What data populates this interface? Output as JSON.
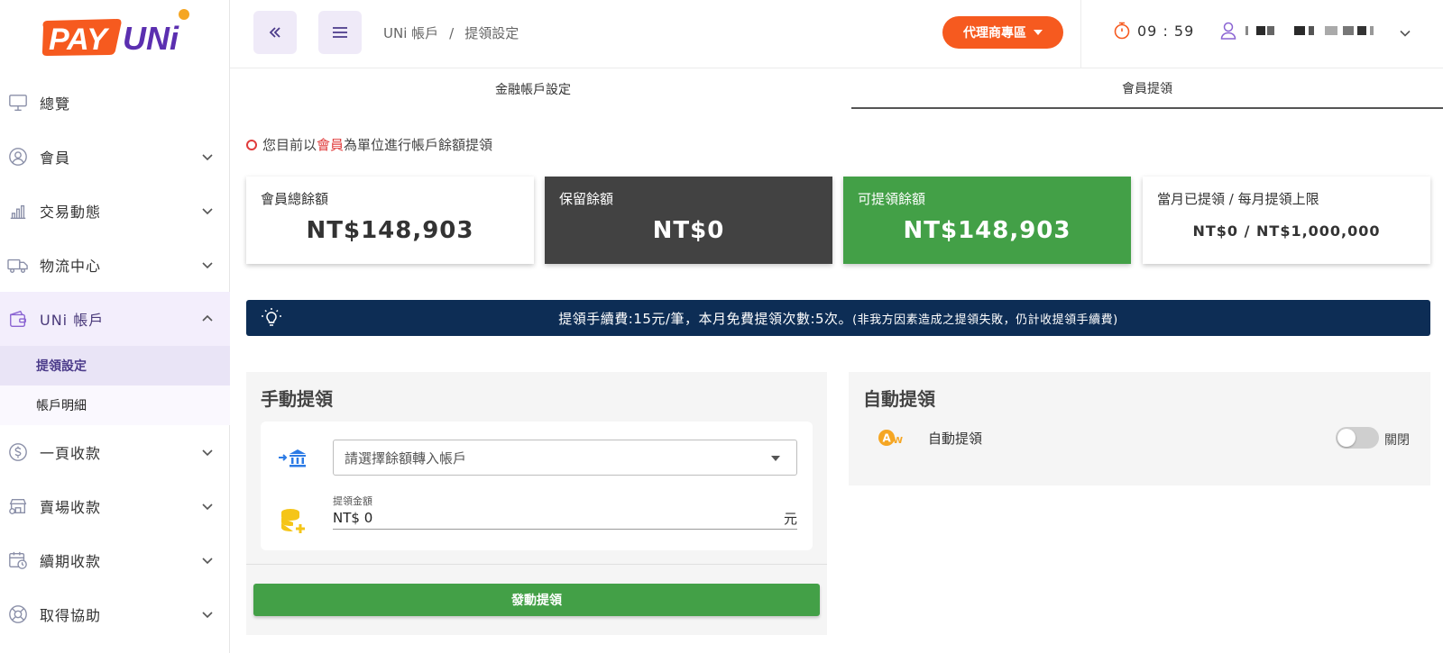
{
  "brand": {
    "logo_text_pay": "PAY",
    "logo_text_uni": "UNi",
    "orange": "#f65a1f",
    "purple": "#5b2fb0"
  },
  "sidebar": {
    "items": [
      {
        "label": "總覽",
        "icon": "monitor-icon",
        "expandable": false
      },
      {
        "label": "會員",
        "icon": "user-circle-icon",
        "expandable": true
      },
      {
        "label": "交易動態",
        "icon": "bar-chart-icon",
        "expandable": true
      },
      {
        "label": "物流中心",
        "icon": "truck-icon",
        "expandable": true
      },
      {
        "label": "UNi 帳戶",
        "icon": "wallet-icon",
        "expandable": true,
        "open": true
      },
      {
        "label": "一頁收款",
        "icon": "dollar-circle-icon",
        "expandable": true
      },
      {
        "label": "賣場收款",
        "icon": "store-icon",
        "expandable": true
      },
      {
        "label": "續期收款",
        "icon": "calendar-clock-icon",
        "expandable": true
      },
      {
        "label": "取得協助",
        "icon": "lifebuoy-icon",
        "expandable": true
      }
    ],
    "subitems": [
      {
        "label": "提領設定",
        "active": true
      },
      {
        "label": "帳戶明細",
        "active": false
      }
    ]
  },
  "topbar": {
    "breadcrumb": [
      "UNi 帳戶",
      "提領設定"
    ],
    "breadcrumb_sep": "/",
    "agent_button": "代理商專區",
    "timer": "09 : 59"
  },
  "tabs": [
    {
      "label": "金融帳戶設定",
      "active": false
    },
    {
      "label": "會員提領",
      "active": true
    }
  ],
  "notice": {
    "prefix": "您目前以",
    "highlight": "會員",
    "suffix": "為單位進行帳戶餘額提領"
  },
  "cards": [
    {
      "label": "會員總餘額",
      "value": "NT$148,903",
      "style": "white"
    },
    {
      "label": "保留餘額",
      "value": "NT$0",
      "style": "dark"
    },
    {
      "label": "可提領餘額",
      "value": "NT$148,903",
      "style": "green"
    },
    {
      "label": "當月已提領 / 每月提領上限",
      "value": "NT$0 / NT$1,000,000",
      "style": "white"
    }
  ],
  "banner": {
    "text": "提領手續費:15元/筆，本月免費提領次數:5次。",
    "note": "(非我方因素造成之提領失敗，仍計收提領手續費)"
  },
  "manual": {
    "title": "手動提領",
    "select_placeholder": "請選擇餘額轉入帳戶",
    "amount_label": "提領金額",
    "amount_value": "NT$ 0",
    "amount_unit": "元",
    "submit_label": "發動提領"
  },
  "auto": {
    "title": "自動提領",
    "row_label": "自動提領",
    "toggle_state": "關閉",
    "toggle_on": false
  },
  "colors": {
    "green": "#43a047",
    "dark": "#424242",
    "navy": "#0d2d55",
    "red": "#e03c3c",
    "accent_bg": "#efeaf8"
  }
}
